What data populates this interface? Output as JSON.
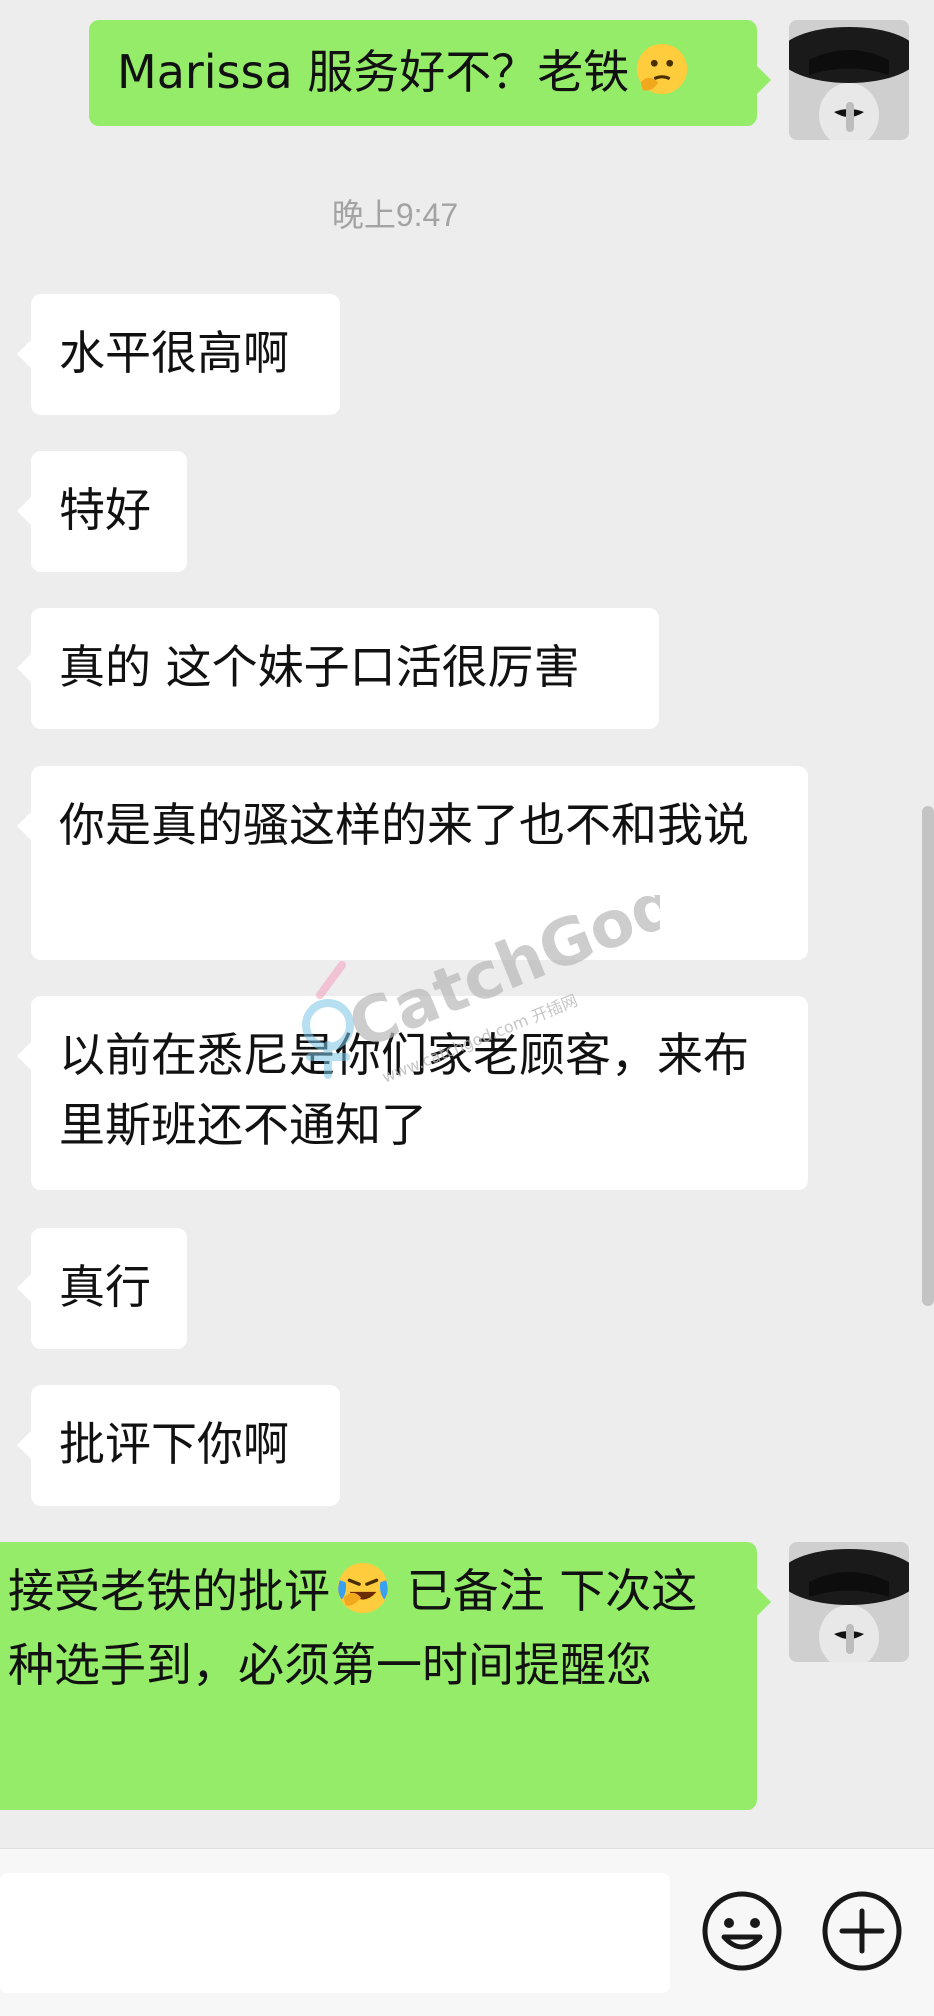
{
  "timestamp": "晚上9:47",
  "messages": [
    {
      "side": "right",
      "text": "Marissa 服务好不？老铁",
      "emoji": "thinking-face"
    },
    {
      "side": "left",
      "text": "水平很高啊"
    },
    {
      "side": "left",
      "text": "特好"
    },
    {
      "side": "left",
      "text": "真的 这个妹子口活很厉害"
    },
    {
      "side": "left",
      "text": "你是真的骚这样的来了也不和我说"
    },
    {
      "side": "left",
      "text": "以前在悉尼是你们家老顾客，来布里斯班还不通知了"
    },
    {
      "side": "left",
      "text": "真行"
    },
    {
      "side": "left",
      "text": "批评下你啊"
    },
    {
      "side": "right",
      "text_before": "接受老铁的批评",
      "emoji": "crying-laughing-face",
      "text_after": " 已备注 下次这种选手到，必须第一时间提醒您"
    }
  ],
  "watermark": {
    "brand": "CatchGod",
    "url": "www.catchgod.com 开插网"
  },
  "toolbar": {
    "emoji_icon": "smiley-icon",
    "plus_icon": "plus-circle-icon"
  },
  "colors": {
    "background": "#ededed",
    "outgoing_bubble": "#95ec69",
    "incoming_bubble": "#ffffff"
  }
}
